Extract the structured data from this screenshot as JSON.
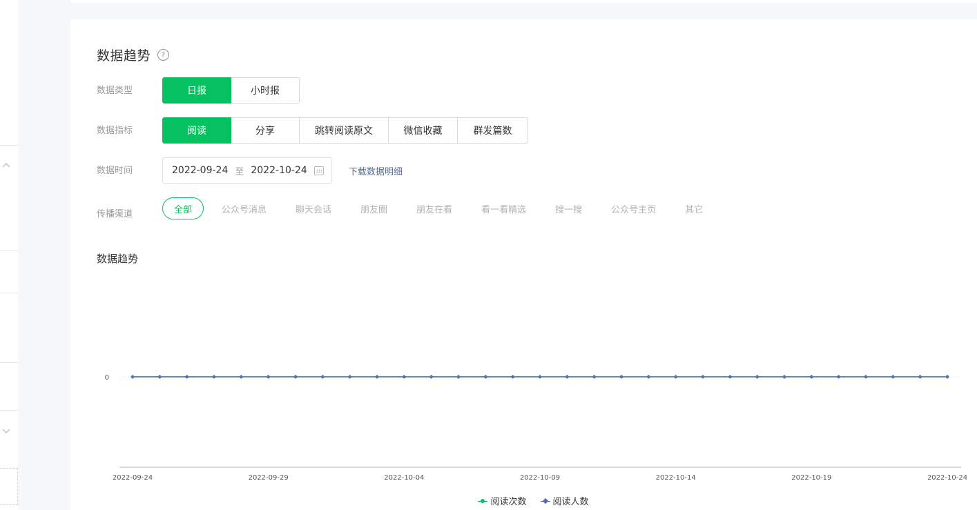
{
  "section": {
    "title": "数据趋势",
    "help": "?"
  },
  "data_type": {
    "label": "数据类型",
    "options": [
      "日报",
      "小时报"
    ],
    "selected": 0
  },
  "data_metric": {
    "label": "数据指标",
    "options": [
      "阅读",
      "分享",
      "跳转阅读原文",
      "微信收藏",
      "群发篇数"
    ],
    "selected": 0
  },
  "data_time": {
    "label": "数据时间",
    "start": "2022-09-24",
    "to": "至",
    "end": "2022-10-24",
    "download": "下载数据明细"
  },
  "channel": {
    "label": "传播渠道",
    "options": [
      "全部",
      "公众号消息",
      "聊天会话",
      "朋友圈",
      "朋友在看",
      "看一看精选",
      "搜一搜",
      "公众号主页",
      "其它"
    ],
    "selected": 0
  },
  "chart_title": "数据趋势",
  "colors": {
    "accent": "#07c160",
    "link": "#576b95",
    "series_read_count": "#07c160",
    "series_read_users": "#5b6ab7"
  },
  "chart_data": {
    "type": "line",
    "x": [
      "2022-09-24",
      "2022-09-25",
      "2022-09-26",
      "2022-09-27",
      "2022-09-28",
      "2022-09-29",
      "2022-09-30",
      "2022-10-01",
      "2022-10-02",
      "2022-10-03",
      "2022-10-04",
      "2022-10-05",
      "2022-10-06",
      "2022-10-07",
      "2022-10-08",
      "2022-10-09",
      "2022-10-10",
      "2022-10-11",
      "2022-10-12",
      "2022-10-13",
      "2022-10-14",
      "2022-10-15",
      "2022-10-16",
      "2022-10-17",
      "2022-10-18",
      "2022-10-19",
      "2022-10-20",
      "2022-10-21",
      "2022-10-22",
      "2022-10-23",
      "2022-10-24"
    ],
    "x_ticks": [
      "2022-09-24",
      "2022-09-29",
      "2022-10-04",
      "2022-10-09",
      "2022-10-14",
      "2022-10-19",
      "2022-10-24"
    ],
    "y_ticks": [
      "0"
    ],
    "series": [
      {
        "name": "阅读次数",
        "values": [
          0,
          0,
          0,
          0,
          0,
          0,
          0,
          0,
          0,
          0,
          0,
          0,
          0,
          0,
          0,
          0,
          0,
          0,
          0,
          0,
          0,
          0,
          0,
          0,
          0,
          0,
          0,
          0,
          0,
          0,
          0
        ]
      },
      {
        "name": "阅读人数",
        "values": [
          0,
          0,
          0,
          0,
          0,
          0,
          0,
          0,
          0,
          0,
          0,
          0,
          0,
          0,
          0,
          0,
          0,
          0,
          0,
          0,
          0,
          0,
          0,
          0,
          0,
          0,
          0,
          0,
          0,
          0,
          0
        ]
      }
    ],
    "legend": "bottom"
  }
}
